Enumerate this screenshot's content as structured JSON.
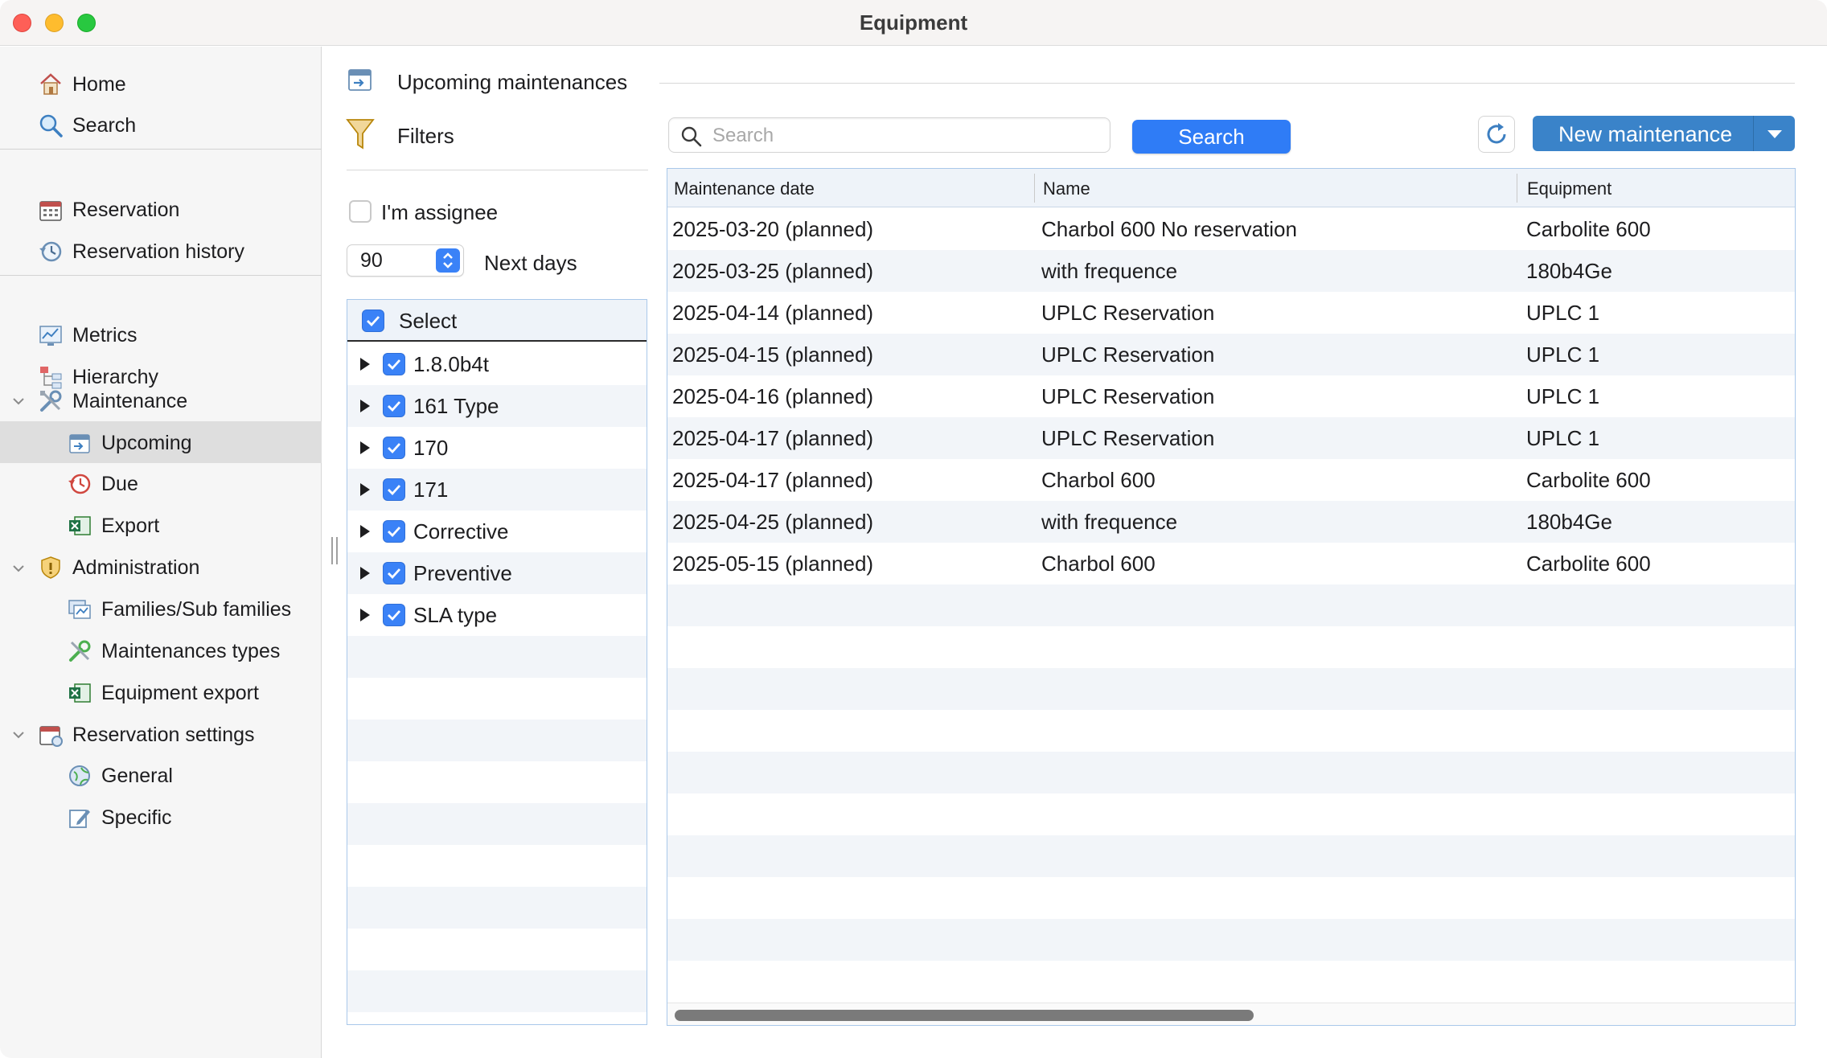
{
  "window": {
    "title": "Equipment"
  },
  "sidebar": {
    "home": "Home",
    "search": "Search",
    "reservation": "Reservation",
    "reservation_history": "Reservation history",
    "metrics": "Metrics",
    "hierarchy": "Hierarchy",
    "maintenance": "Maintenance",
    "upcoming": "Upcoming",
    "due": "Due",
    "export": "Export",
    "administration": "Administration",
    "families": "Families/Sub families",
    "maintenances_types": "Maintenances types",
    "equipment_export": "Equipment export",
    "reservation_settings": "Reservation settings",
    "general": "General",
    "specific": "Specific",
    "selected_item": "Upcoming"
  },
  "header": {
    "section_title": "Upcoming maintenances",
    "filters_label": "Filters"
  },
  "filters": {
    "assignee_label": "I'm assignee",
    "assignee_checked": false,
    "next_days_value": "90",
    "next_days_label": "Next days",
    "select_all_label": "Select",
    "types": [
      {
        "label": "1.8.0b4t",
        "checked": true
      },
      {
        "label": "161 Type",
        "checked": true
      },
      {
        "label": "170",
        "checked": true
      },
      {
        "label": "171",
        "checked": true
      },
      {
        "label": "Corrective",
        "checked": true
      },
      {
        "label": "Preventive",
        "checked": true
      },
      {
        "label": "SLA type",
        "checked": true
      }
    ]
  },
  "toolbar": {
    "search_placeholder": "Search",
    "search_value": "",
    "search_button": "Search",
    "new_button": "New maintenance"
  },
  "table": {
    "columns": [
      "Maintenance date",
      "Name",
      "Equipment"
    ],
    "rows": [
      [
        "2025-03-20 (planned)",
        "Charbol 600 No reservation",
        "Carbolite 600"
      ],
      [
        "2025-03-25 (planned)",
        "with frequence",
        "180b4Ge"
      ],
      [
        "2025-04-14 (planned)",
        "UPLC Reservation",
        "UPLC 1"
      ],
      [
        "2025-04-15 (planned)",
        "UPLC Reservation",
        "UPLC 1"
      ],
      [
        "2025-04-16 (planned)",
        "UPLC Reservation",
        "UPLC 1"
      ],
      [
        "2025-04-17 (planned)",
        "UPLC Reservation",
        "UPLC 1"
      ],
      [
        "2025-04-17 (planned)",
        "Charbol 600",
        "Carbolite 600"
      ],
      [
        "2025-04-25 (planned)",
        "with frequence",
        "180b4Ge"
      ],
      [
        "2025-05-15 (planned)",
        "Charbol 600",
        "Carbolite 600"
      ]
    ]
  },
  "colors": {
    "accent": "#2f7cf6",
    "new_button": "#3a83c9",
    "selected_sidebar": "#dedede",
    "grid_border": "#a9c8ea"
  }
}
